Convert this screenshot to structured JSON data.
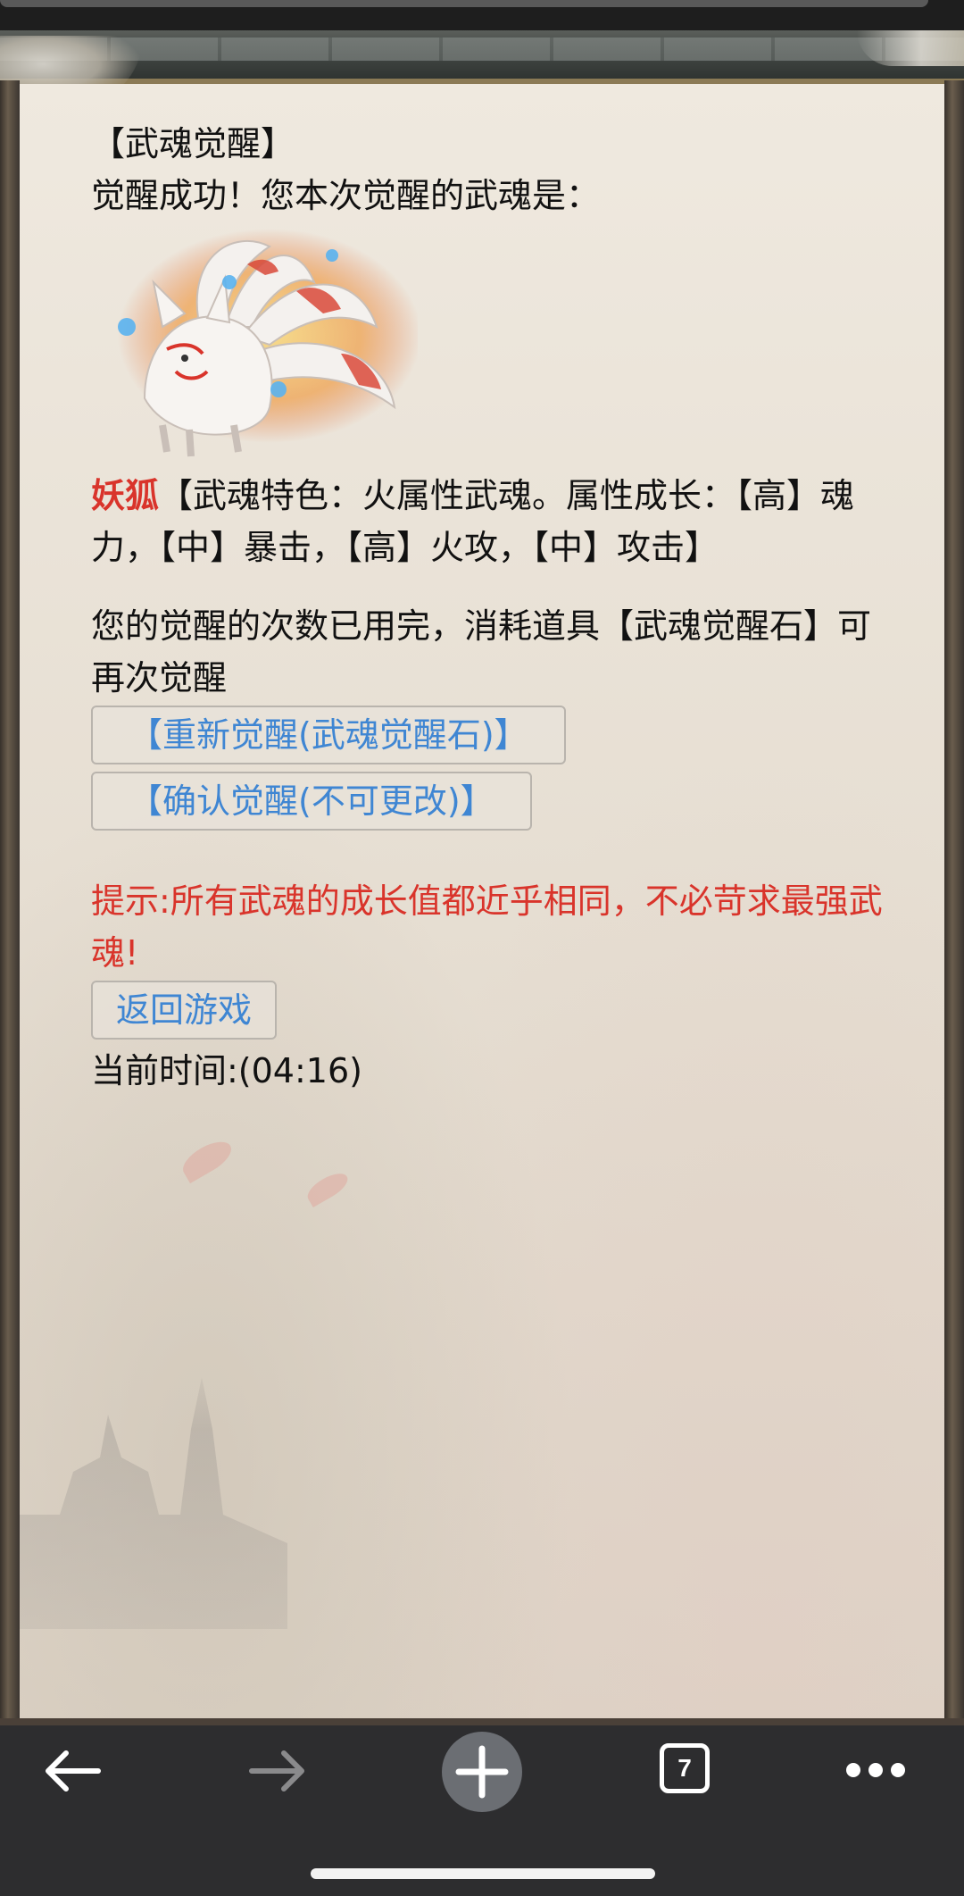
{
  "page": {
    "title": "【武魂觉醒】",
    "success_text": "觉醒成功！您本次觉醒的武魂是：",
    "pet": {
      "name": "妖狐",
      "image_icon": "nine-tailed-fox-icon",
      "description": "【武魂特色：火属性武魂。属性成长：【高】魂力，【中】暴击，【高】火攻，【中】攻击】"
    },
    "notice": "您的觉醒的次数已用完，消耗道具【武魂觉醒石】可再次觉醒",
    "buttons": {
      "reawaken": "【重新觉醒(武魂觉醒石)】",
      "confirm": "【确认觉醒(不可更改)】",
      "return": "返回游戏"
    },
    "tip": "提示:所有武魂的成长值都近乎相同，不必苛求最强武魂!",
    "time": "当前时间:(04:16)"
  },
  "browser": {
    "tab_count": "7",
    "back_icon": "back-arrow-icon",
    "forward_icon": "forward-arrow-icon",
    "new_tab_icon": "plus-icon",
    "menu_icon": "more-icon"
  },
  "colors": {
    "accent_red": "#d9342b",
    "link_blue": "#3f86d3"
  }
}
